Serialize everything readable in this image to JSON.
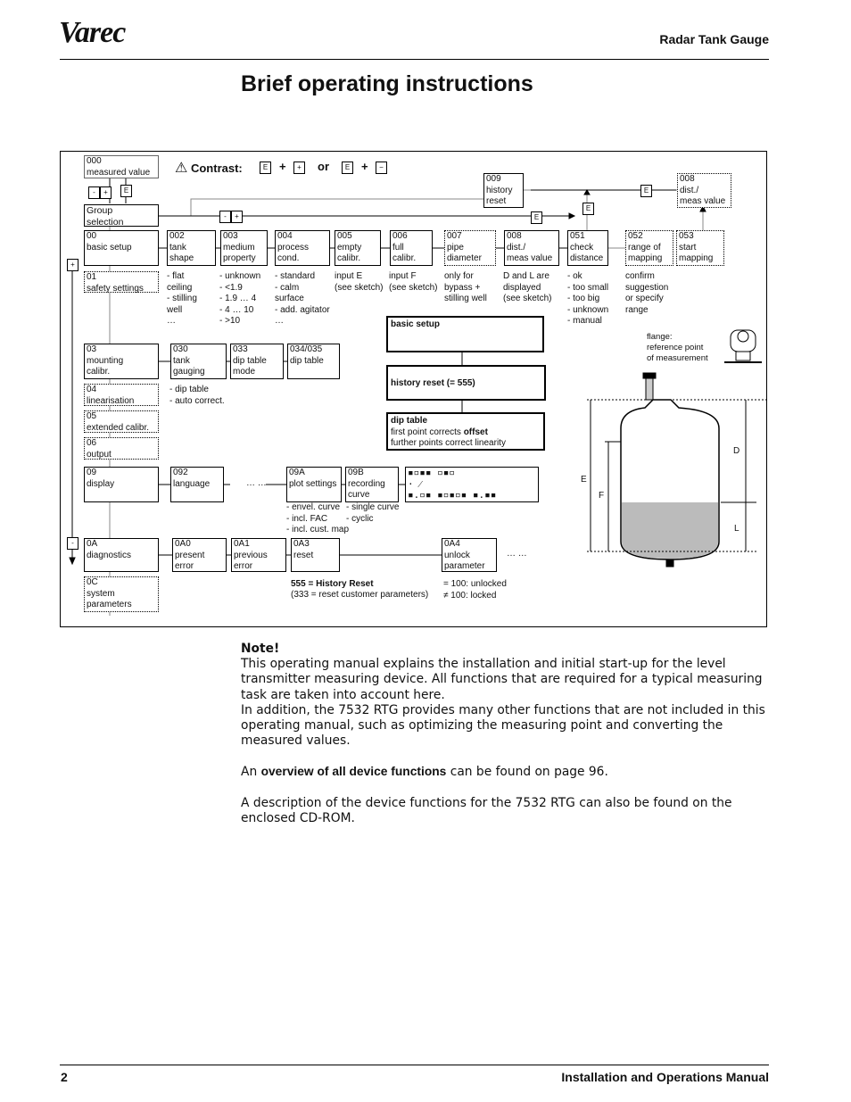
{
  "header": {
    "logo": "Varec",
    "title": "Radar Tank Gauge"
  },
  "page_title": "Brief operating instructions",
  "diagram": {
    "contrast": {
      "label": "Contrast:",
      "or": "or",
      "key_e": "E",
      "plus": "+",
      "key_plus": "+",
      "key_minus": "−"
    },
    "keys": {
      "e": "E",
      "minus": "-",
      "plus": "+"
    },
    "boxes": {
      "b000": "000\nmeasured value",
      "group": "Group\nselection",
      "b00": "00\nbasic setup",
      "b01": "01\nsafety settings",
      "b002": "002\ntank\nshape",
      "b003": "003\nmedium\nproperty",
      "b004": "004\nprocess\ncond.",
      "b005": "005\nempty\ncalibr.",
      "b006": "006\nfull\ncalibr.",
      "b007": "007\npipe\ndiameter",
      "b008": "008\ndist./\nmeas value",
      "b051": "051\ncheck\ndistance",
      "b052": "052\nrange of\nmapping",
      "b053": "053\nstart\nmapping",
      "b009": "009\nhistory\nreset",
      "b008top": "008\ndist./\nmeas value",
      "b03": "03\nmounting\ncalibr.",
      "b030": "030\ntank\ngauging",
      "b033": "033\ndip table\nmode",
      "b034": "034/035\ndip table",
      "b04": "04\nlinearisation",
      "b05": "05\nextended calibr.",
      "b06": "06\noutput",
      "b09": "09\ndisplay",
      "b092": "092\nlanguage",
      "b09A": "09A\nplot settings",
      "b09B": "09B\nrecording\ncurve",
      "b0A": "0A\ndiagnostics",
      "b0A0": "0A0\npresent\nerror",
      "b0A1": "0A1\nprevious\nerror",
      "b0A3": "0A3\nreset",
      "b0A4": "0A4\nunlock\nparameter",
      "b0C": "0C\nsystem\nparameters"
    },
    "options": {
      "tank_shape": "- flat\n   ceiling\n- stilling\n   well\n      …",
      "medium": "- unknown\n- <1.9\n- 1.9 … 4\n- 4 … 10\n- >10",
      "process": "- standard\n- calm\n   surface\n- add. agitator\n      …",
      "empty": "input E\n(see sketch)",
      "full": "input F\n(see sketch)",
      "pipe": "only for\nbypass +\nstilling well",
      "dist": "D and L are\ndisplayed\n(see sketch)",
      "check": "- ok\n- too small\n- too big\n- unknown\n- manual",
      "range": "confirm\nsuggestion\nor specify\nrange",
      "tank_gauging": "- dip table\n- auto correct.",
      "plot": "- envel. curve\n- incl. FAC\n- incl. cust. map",
      "recording": "- single curve\n- cyclic",
      "ellipsis": "… …",
      "history_reset_bold": "555 = History Reset",
      "history_reset_note": "(333 = reset customer parameters)",
      "unlock": "= 100: unlocked\n≠ 100: locked"
    },
    "flow": {
      "basic_setup": "basic setup",
      "history_reset": "history reset (= 555)",
      "dip_title": "dip table",
      "dip_l1_pre": "first point corrects ",
      "dip_l1_bold": "offset",
      "dip_l2": "further points correct linearity"
    },
    "sketch": {
      "flange": "flange:\nreference point\nof measurement",
      "E": "E",
      "F": "F",
      "D": "D",
      "L": "L"
    }
  },
  "note": {
    "heading": "Note!",
    "p1": "This operating manual explains the installation and initial start-up for the level transmitter measuring device. All functions that are required for a typical measuring task are taken into account here.",
    "p2": "In addition, the 7532 RTG provides many other functions that are not included in this operating manual, such as optimizing the measuring point and converting the measured values.",
    "p3_pre": "An ",
    "p3_bold": "overview of all device functions",
    "p3_post": " can be found on page 96.",
    "p4": "A description of the device functions for the 7532 RTG can also be found on the enclosed CD-ROM."
  },
  "footer": {
    "page": "2",
    "title": "Installation and Operations Manual"
  }
}
